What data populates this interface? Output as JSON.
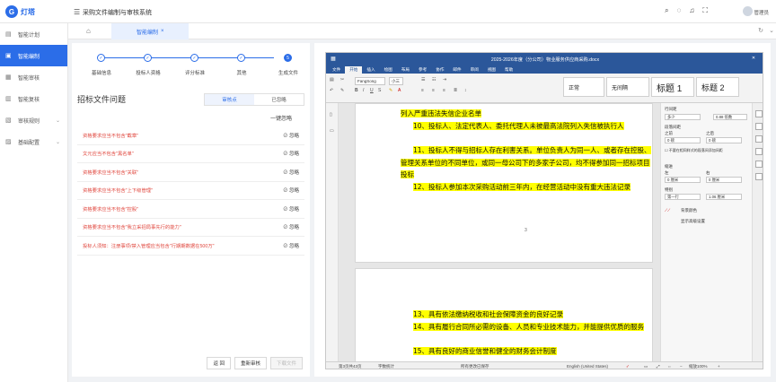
{
  "brand": {
    "name": "灯塔",
    "logo_text": "G"
  },
  "header": {
    "app_title": "采购文件编制与审核系统",
    "user": "管理员"
  },
  "sidebar": {
    "items": [
      {
        "label": "智能计划",
        "icon": "calendar-icon"
      },
      {
        "label": "智能编制",
        "icon": "edit-icon",
        "active": true
      },
      {
        "label": "智能审核",
        "icon": "audit-icon"
      },
      {
        "label": "智能复核",
        "icon": "recheck-icon"
      },
      {
        "label": "审核规则",
        "icon": "rules-icon",
        "caret": "⌄"
      },
      {
        "label": "基础配置",
        "icon": "config-icon",
        "caret": "⌄"
      }
    ]
  },
  "tabs": {
    "home_icon": "home-icon",
    "active": "智能编制",
    "close": "×"
  },
  "steps": {
    "items": [
      {
        "label": "基础信息",
        "mark": "✓"
      },
      {
        "label": "投标人资格",
        "mark": "✓"
      },
      {
        "label": "评分标准",
        "mark": "✓"
      },
      {
        "label": "其他",
        "mark": "✓"
      },
      {
        "label": "生成文件",
        "mark": "5"
      }
    ]
  },
  "issues": {
    "title": "招标文件问题",
    "tabs": [
      "审核点",
      "已忽略"
    ],
    "ignore_all": "一键忽略",
    "ignore_label": "忽略",
    "items": [
      "资格要求应当不包含\"截章\"",
      "文元应当不包含\"黑名单\"",
      "资格要求应当不包含\"关联\"",
      "资格要求应当不包含\"上下级管理\"",
      "资格要求应当不包含\"控股\"",
      "资格要求应当不包含\"我立采招局事先行的能力\"",
      "投标人须知：注册事项/禁入管理应当包含\"行期期数据在500万\""
    ]
  },
  "actions": {
    "back": "返 回",
    "restart": "重新审核",
    "download": "下载文件"
  },
  "word": {
    "title": "2025-2026年度（分公司）物业服务供应商采购.docx",
    "menu": [
      "文件",
      "开始",
      "插入",
      "绘图",
      "布局",
      "参考",
      "协作",
      "邮件",
      "审阅",
      "视图",
      "帮助"
    ],
    "active_menu": "开始",
    "font_name": "FangSong",
    "font_size": "小三",
    "styles": [
      "正常",
      "无间隔",
      "标题 1",
      "标题 2"
    ],
    "page1": [
      {
        "text": "列入严重违法失信企业名单",
        "indent": false
      },
      {
        "text": "10、投标人、法定代表人、委托代理人未被最高法院列入失信被执行人",
        "indent": true
      },
      {
        "text": "11、投标人不得与招标人存在利害关系。单位负责人为同一人、或者存在控股、管理关系单位的不同单位，或同一母公司下的多家子公司，均不得参加同一招标项目投标",
        "indent": true
      },
      {
        "text": "12、投标人参加本次采购活动前三年内，在经营活动中没有重大违法记录",
        "indent": true
      }
    ],
    "page1_number": "3",
    "page2": [
      {
        "text": "13、具有依法缴纳税收和社会保障资金的良好记录",
        "indent": true
      },
      {
        "text": "14、具有履行合同所必需的设备、人员和专业技术能力，并能提供优质的服务",
        "indent": true
      },
      {
        "text": "15、具有良好的商业信誉和健全的财务会计制度",
        "indent": true
      }
    ],
    "props": {
      "line_spacing_label": "行间距",
      "line_spacing": "多少",
      "line_val": "0.88 倍数",
      "para_spacing_label": "段落间距",
      "before": "之前",
      "after": "之后",
      "before_val": "0 磅",
      "after_val": "0 磅",
      "no_space": "不要在相同样式的段落间添加间距",
      "indent_label": "缩进",
      "left": "左",
      "right": "右",
      "left_val": "0 厘米",
      "right_val": "0 厘米",
      "special_label": "特别",
      "special": "第一行",
      "special_val": "1.06 厘米",
      "shading": "背景颜色",
      "more": "显示高级设置"
    },
    "status": {
      "page": "第3页共43页",
      "words": "字数统计",
      "saved": "所有更改已保存",
      "lang": "English (United States)",
      "zoom": "缩放100%"
    }
  }
}
